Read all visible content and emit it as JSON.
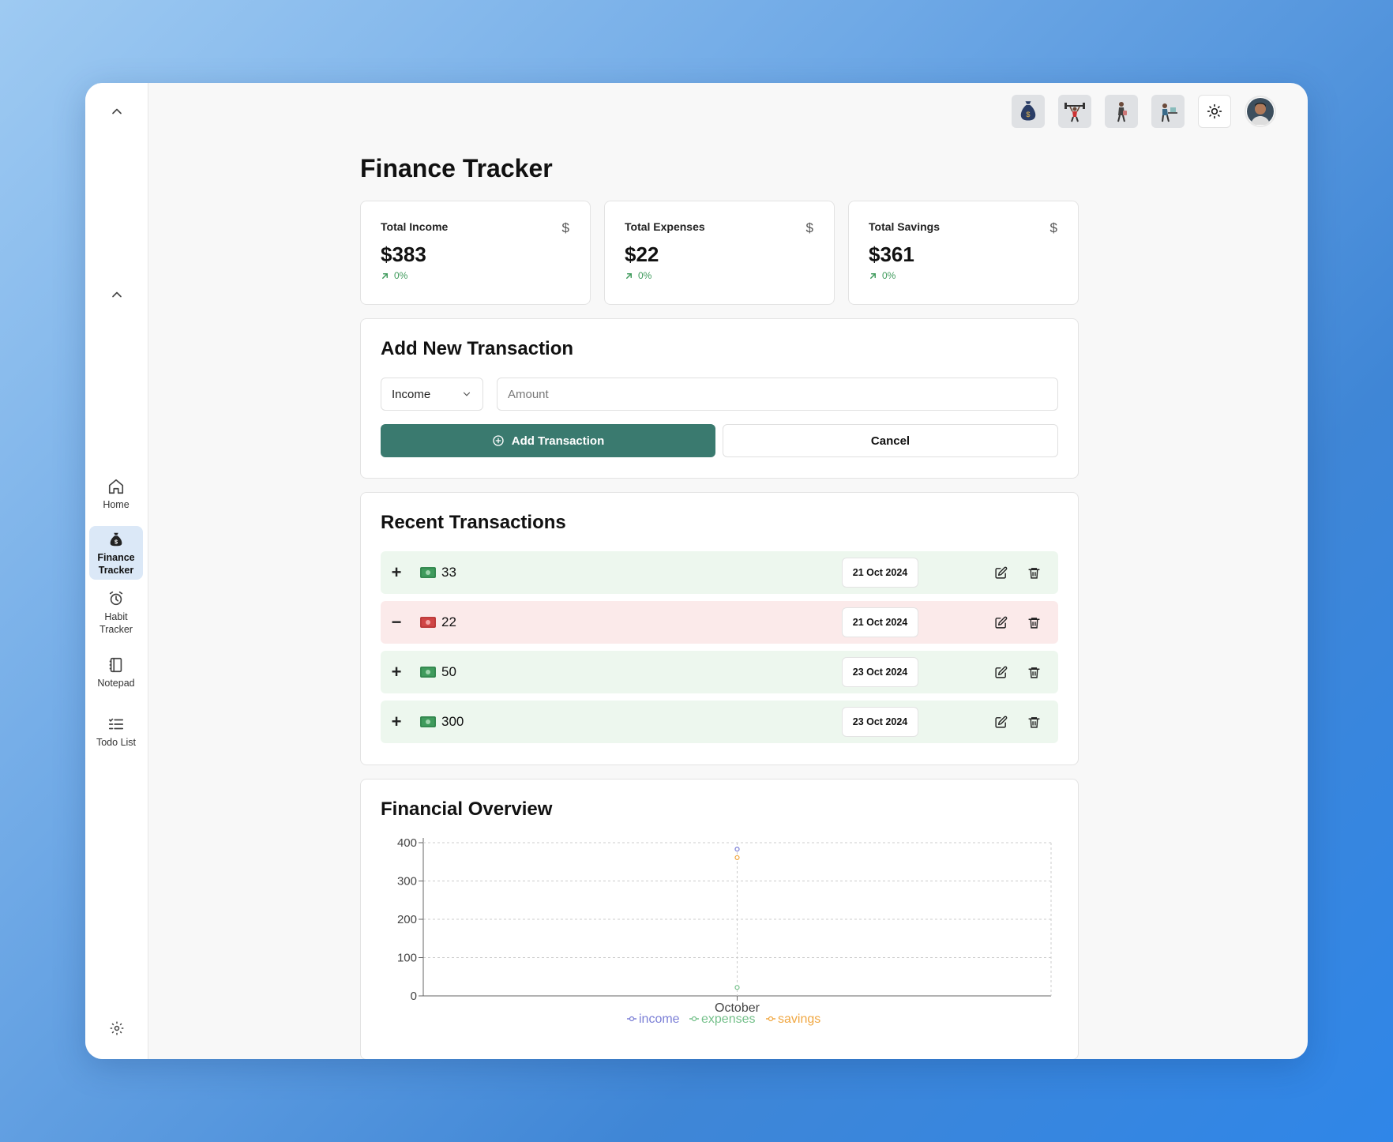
{
  "sidebar": {
    "items": [
      {
        "label": "Home",
        "icon": "home-icon"
      },
      {
        "label": "Finance Tracker",
        "icon": "money-bag-icon",
        "active": true
      },
      {
        "label": "Habit Tracker",
        "icon": "alarm-clock-icon"
      },
      {
        "label": "Notepad",
        "icon": "notebook-icon"
      },
      {
        "label": "Todo List",
        "icon": "list-check-icon"
      }
    ]
  },
  "header": {
    "title": "Finance Tracker"
  },
  "stats": [
    {
      "label": "Total Income",
      "currency": "$",
      "value": "$383",
      "trend": "0%"
    },
    {
      "label": "Total Expenses",
      "currency": "$",
      "value": "$22",
      "trend": "0%"
    },
    {
      "label": "Total Savings",
      "currency": "$",
      "value": "$361",
      "trend": "0%"
    }
  ],
  "add_form": {
    "title": "Add New Transaction",
    "type_value": "Income",
    "amount_placeholder": "Amount",
    "add_label": "Add Transaction",
    "cancel_label": "Cancel"
  },
  "recent": {
    "title": "Recent Transactions",
    "transactions": [
      {
        "sign": "+",
        "type": "income",
        "amount": "33",
        "date": "21 Oct 2024"
      },
      {
        "sign": "−",
        "type": "expense",
        "amount": "22",
        "date": "21 Oct 2024"
      },
      {
        "sign": "+",
        "type": "income",
        "amount": "50",
        "date": "23 Oct 2024"
      },
      {
        "sign": "+",
        "type": "income",
        "amount": "300",
        "date": "23 Oct 2024"
      }
    ]
  },
  "overview": {
    "title": "Financial Overview"
  },
  "colors": {
    "primary": "#3a7a6f",
    "income": "#7b7fd6",
    "expenses": "#74c08a",
    "savings": "#f0a742",
    "income_row": "#edf7ee",
    "expense_row": "#fbeaea"
  },
  "chart_data": {
    "type": "line",
    "categories": [
      "October"
    ],
    "series": [
      {
        "name": "income",
        "values": [
          383
        ],
        "color": "#7b7fd6"
      },
      {
        "name": "expenses",
        "values": [
          22
        ],
        "color": "#74c08a"
      },
      {
        "name": "savings",
        "values": [
          361
        ],
        "color": "#f0a742"
      }
    ],
    "yticks": [
      0,
      100,
      200,
      300,
      400
    ],
    "ylim": [
      0,
      400
    ],
    "grid": true,
    "legend_position": "bottom"
  }
}
